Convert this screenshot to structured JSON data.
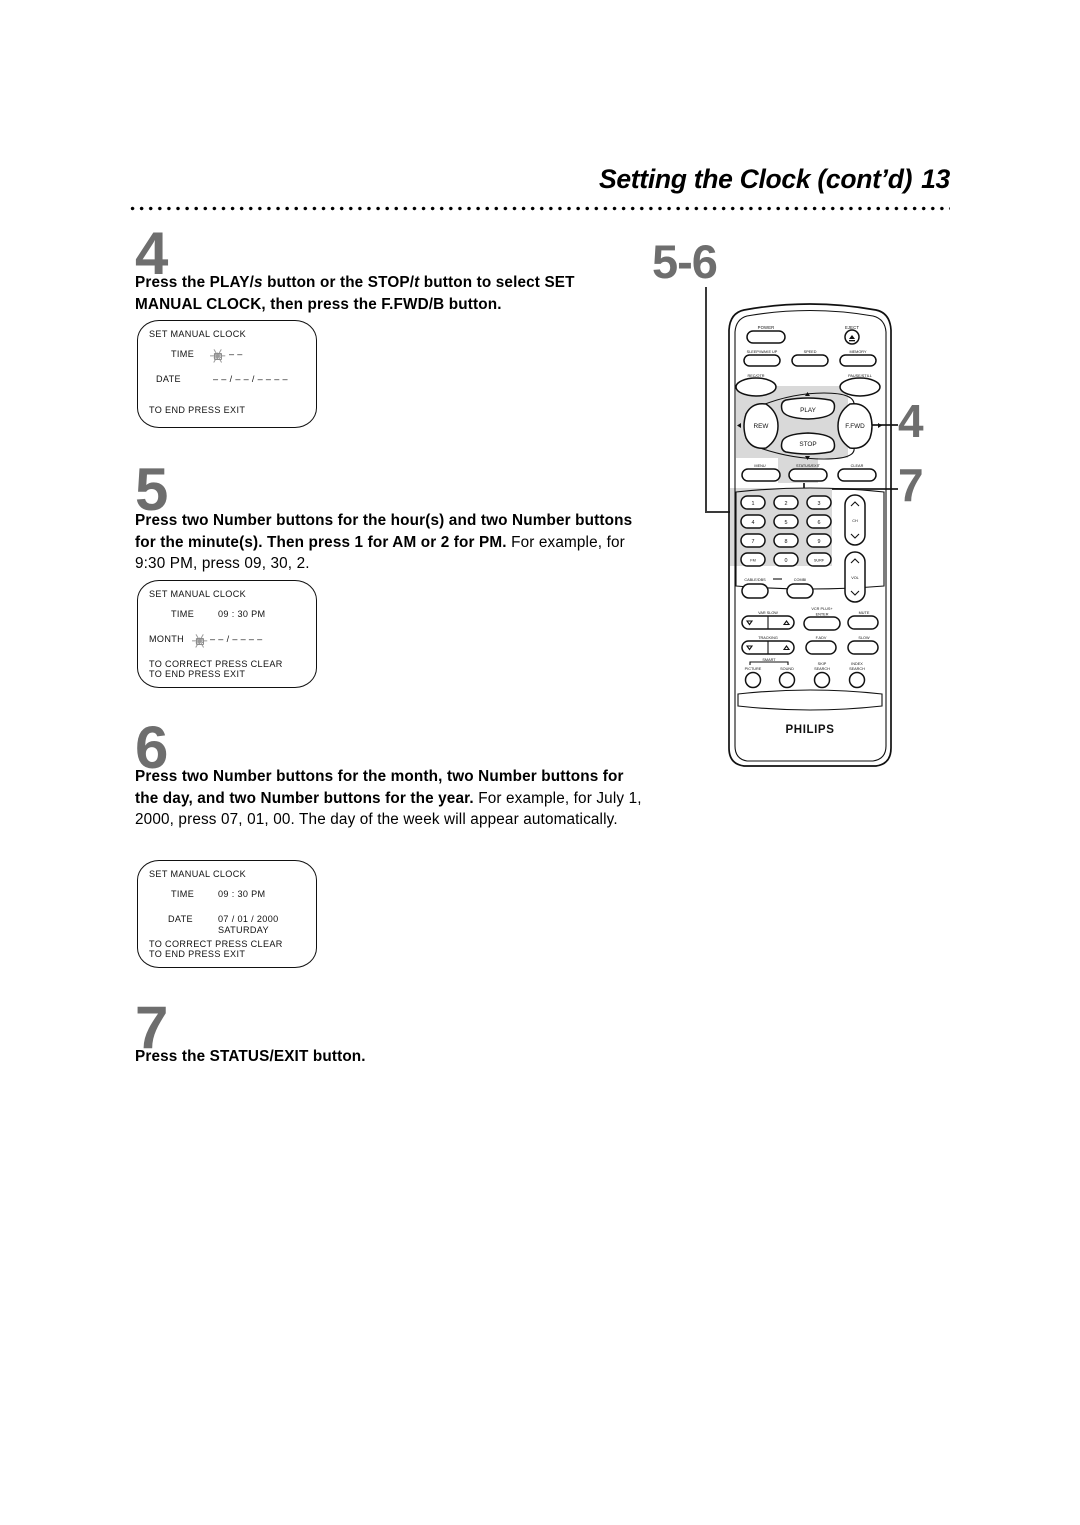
{
  "header": {
    "title": "Setting the Clock (cont’d)",
    "page_number": "13"
  },
  "steps": [
    {
      "number": "4",
      "text_bold_1": "Press the PLAY/",
      "sym_1": "s",
      "text_bold_2": " button or the STOP/",
      "sym_2": "t",
      "text_bold_3": " button to select SET MANUAL CLOCK, then press the F.FWD/",
      "sym_3": "B",
      "text_bold_4": " button."
    },
    {
      "number": "5",
      "bold": "Press two Number buttons for the hour(s) and two Number buttons for the minute(s). Then press 1 for AM or 2 for PM.",
      "regular": " For example, for 9:30 PM, press 09, 30, 2."
    },
    {
      "number": "6",
      "bold": "Press two Number buttons for the month, two Number buttons for the day, and two Number buttons for the year.",
      "regular": " For example, for July 1, 2000, press 07, 01, 00. The day of the week will appear automatically."
    },
    {
      "number": "7",
      "bold": "Press the STATUS/EXIT button."
    }
  ],
  "osd_screens": [
    {
      "title": "SET MANUAL CLOCK",
      "label_1": "TIME",
      "value_1": "– –",
      "label_2": "DATE",
      "value_2": "– – / – – / – – – –",
      "footer_1": "TO END PRESS EXIT",
      "footer_2": ""
    },
    {
      "title": "SET MANUAL CLOCK",
      "label_1": "TIME",
      "value_1": "09 : 30 PM",
      "label_2": "MONTH",
      "value_2": "– – / – – – –",
      "footer_1": "TO CORRECT PRESS CLEAR",
      "footer_2": "TO END PRESS EXIT"
    },
    {
      "title": "SET MANUAL CLOCK",
      "label_1": "TIME",
      "value_1": "09 : 30 PM",
      "label_2": "DATE",
      "value_2": "07 / 01 / 2000",
      "value_3": "SATURDAY",
      "footer_1": "TO CORRECT PRESS CLEAR",
      "footer_2": "TO END PRESS EXIT"
    }
  ],
  "callouts": {
    "steps_5_6": "5-6",
    "step_4": "4",
    "step_7": "7"
  },
  "remote": {
    "brand": "PHILIPS",
    "buttons": {
      "power": "POWER",
      "eject": "EJECT",
      "sleep_wake_up": "SLEEP/WAKE UP",
      "speed": "SPEED",
      "memory": "MEMORY",
      "rec_otr": "REC/OTR",
      "pause_still": "PAUSE/STILL",
      "play": "PLAY",
      "rew": "REW",
      "f_fwd": "F.FWD",
      "stop": "STOP",
      "menu": "MENU",
      "status_exit": "STATUS/EXIT",
      "clear": "CLEAR",
      "ch": "CH",
      "vol": "VOL",
      "fm": "FM",
      "surf": "SURF",
      "cable_dbs": "CABLE/DBS",
      "combi": "COMBI",
      "var_slow": "VAR SLOW",
      "vcr_plus": "VCR PLUS+",
      "enter": "ENTER",
      "mute": "MUTE",
      "tracking": "TRACKING",
      "f_adv": "F.ADV",
      "slow": "SLOW",
      "smart": "SMART",
      "picture": "PICTURE",
      "sound": "SOUND",
      "skip_search_1": "SKIP",
      "skip_search_2": "SEARCH",
      "index_search_1": "INDEX",
      "index_search_2": "SEARCH"
    },
    "keypad": [
      "1",
      "2",
      "3",
      "4",
      "5",
      "6",
      "7",
      "8",
      "9"
    ]
  },
  "colors": {
    "step_number": "#6e6e6e",
    "highlight": "#d9d9d9",
    "ink": "#111111"
  }
}
